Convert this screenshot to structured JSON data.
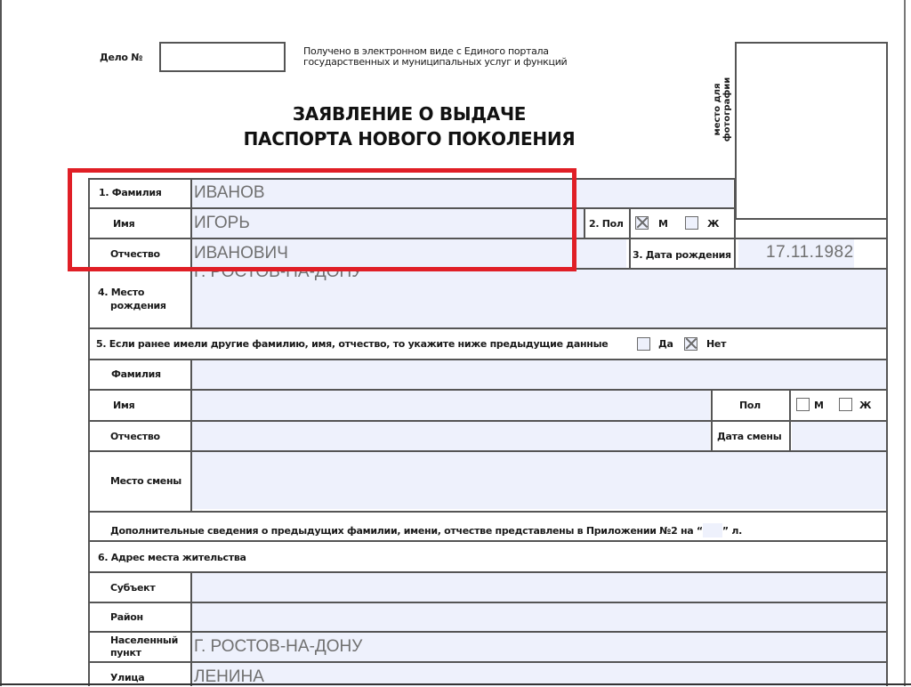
{
  "header": {
    "case_label": "Дело №",
    "case_value": "",
    "received_line1": "Получено в электронном виде с Единого портала",
    "received_line2": "государственных и муниципальных услуг и функций",
    "photo_label": "место для фотографии",
    "title_line1": "ЗАЯВЛЕНИЕ О ВЫДАЧЕ",
    "title_line2": "ПАСПОРТА НОВОГО ПОКОЛЕНИЯ"
  },
  "section1": {
    "surname_label": "1. Фамилия",
    "surname_value": "ИВАНОВ",
    "name_label": "Имя",
    "name_value": "ИГОРЬ",
    "patronymic_label": "Отчество",
    "patronymic_value": "ИВАНОВИЧ"
  },
  "section2": {
    "sex_label": "2. Пол",
    "male_label": "М",
    "female_label": "Ж",
    "male_checked": true,
    "female_checked": false
  },
  "section3": {
    "dob_label": "3. Дата рождения",
    "dob_value": "17.11.1982"
  },
  "section4": {
    "birthplace_label_line1": "4. Место",
    "birthplace_label_line2": "рождения",
    "birthplace_value": "Г. РОСТОВ-НА-ДОНУ"
  },
  "section5": {
    "question": "5. Если ранее имели другие фамилию, имя, отчество, то укажите ниже предыдущие данные",
    "yes_label": "Да",
    "no_label": "Нет",
    "yes_checked": false,
    "no_checked": true,
    "surname_label": "Фамилия",
    "surname_value": "",
    "name_label": "Имя",
    "name_value": "",
    "patronymic_label": "Отчество",
    "patronymic_value": "",
    "sex_label": "Пол",
    "male_label": "М",
    "female_label": "Ж",
    "change_date_label": "Дата смены",
    "change_date_value": "",
    "change_place_label": "Место смены",
    "change_place_value": "",
    "appendix_text_before": "Дополнительные сведения о предыдущих фамилии, имени, отчестве представлены в Приложении №2 на “",
    "appendix_pages_value": "",
    "appendix_text_after": "” л."
  },
  "section6": {
    "title": "6. Адрес места жительства",
    "subject_label": "Субъект",
    "subject_value": "",
    "district_label": "Район",
    "district_value": "",
    "locality_label_line1": "Населенный",
    "locality_label_line2": "пункт",
    "locality_value": "Г. РОСТОВ-НА-ДОНУ",
    "street_label": "Улица",
    "street_value": "ЛЕНИНА"
  },
  "colors": {
    "highlight_box": "#e01f26",
    "field_fill": "#eef1fc",
    "field_text": "#707070"
  }
}
